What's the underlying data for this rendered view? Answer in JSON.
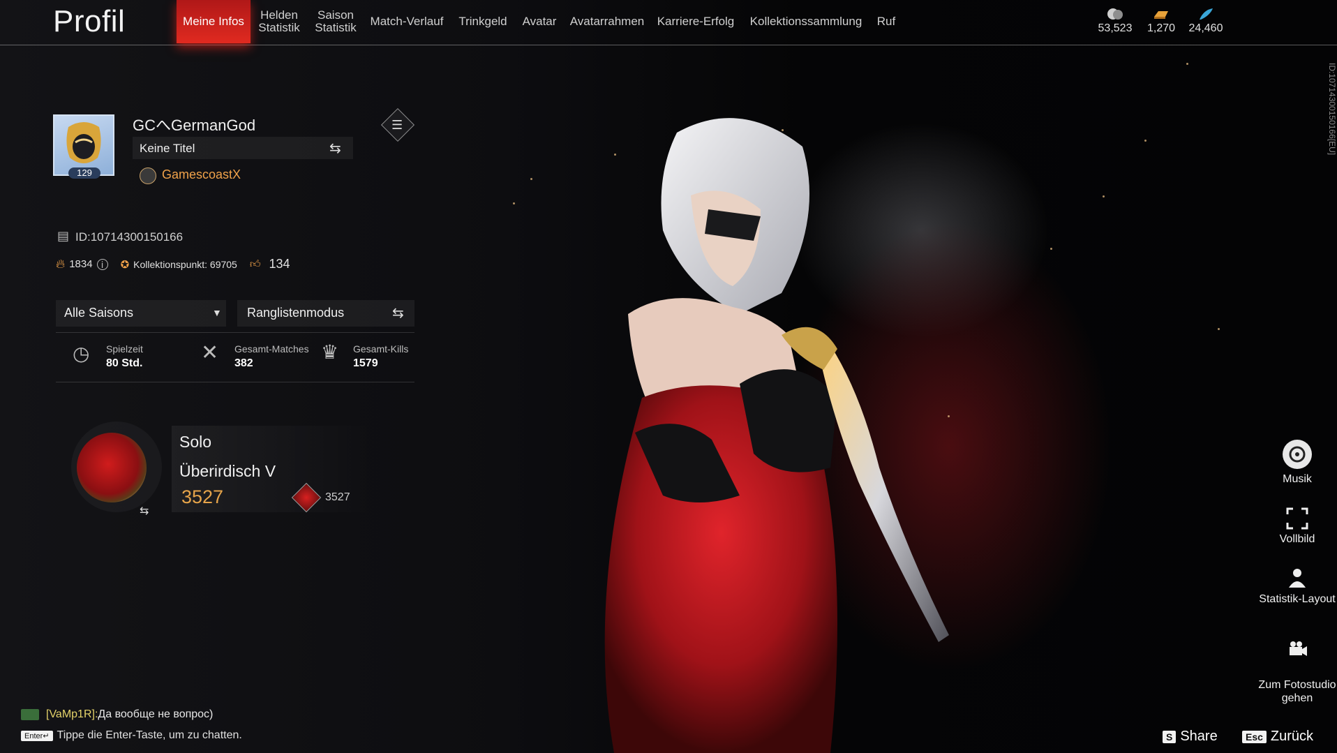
{
  "header": {
    "page_title": "Profil",
    "tabs": [
      {
        "label": "Meine Infos",
        "active": true
      },
      {
        "label": "Helden\nStatistik",
        "active": false
      },
      {
        "label": "Saison\nStatistik",
        "active": false
      },
      {
        "label": "Match-Verlauf",
        "active": false
      },
      {
        "label": "Trinkgeld",
        "active": false
      },
      {
        "label": "Avatar",
        "active": false
      },
      {
        "label": "Avatarrahmen",
        "active": false
      },
      {
        "label": "Karriere-Erfolg",
        "active": false
      },
      {
        "label": "Kollektionssammlung",
        "active": false
      },
      {
        "label": "Ruf",
        "active": false
      }
    ],
    "currencies": [
      {
        "icon": "coin-stack-icon",
        "value": "53,523"
      },
      {
        "icon": "gold-bar-icon",
        "value": "1,270"
      },
      {
        "icon": "feather-icon",
        "value": "24,460"
      }
    ]
  },
  "profile": {
    "level": "129",
    "name": "GCへGermanGod",
    "title": "Keine Titel",
    "club": "GamescoastX",
    "id": "ID:10714300150166",
    "heat": "1834",
    "collection_points": "Kollektionspunkt: 69705",
    "likes": "134"
  },
  "filters": {
    "season": "Alle Saisons",
    "mode": "Ranglistenmodus"
  },
  "stats": [
    {
      "label": "Spielzeit",
      "value": "80 Std."
    },
    {
      "label": "Gesamt-Matches",
      "value": "382"
    },
    {
      "label": "Gesamt-Kills",
      "value": "1579"
    }
  ],
  "rank": {
    "mode": "Solo",
    "tier": "Überirdisch V",
    "score": "3527",
    "points": "3527"
  },
  "side_tools": [
    {
      "label": "Musik",
      "icon": "music-disc-icon"
    },
    {
      "label": "Vollbild",
      "icon": "fullscreen-icon"
    },
    {
      "label": "Statistik-Layout",
      "icon": "stats-layout-icon"
    },
    {
      "label": "Zum Fotostudio\ngehen",
      "icon": "camera-icon"
    }
  ],
  "vertical_id": "ID:10714300150166[EU]",
  "chat": {
    "sender": "[VaMp1R]:",
    "message": "Да вообще не вопрос)",
    "enter_key": "Enter↵",
    "hint": "Tippe die Enter-Taste, um zu chatten."
  },
  "footer": {
    "share_key": "S",
    "share_label": "Share",
    "back_key": "Esc",
    "back_label": "Zurück"
  },
  "colors": {
    "accent_red": "#e02a20",
    "gold": "#f0a24a",
    "chat_name": "#e6d46a"
  }
}
